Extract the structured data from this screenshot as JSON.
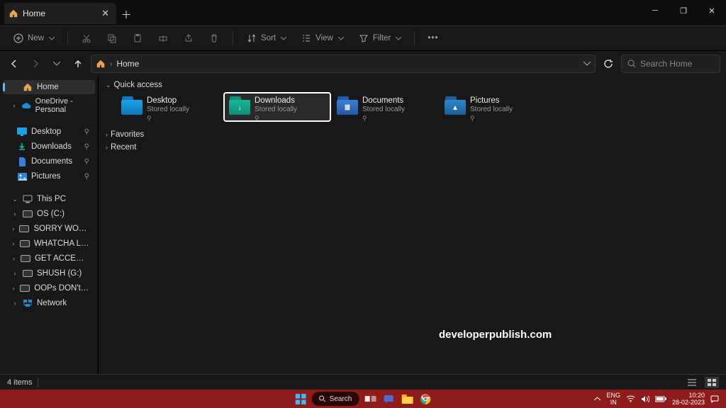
{
  "window": {
    "tab_title": "Home",
    "new_button": "New",
    "toolbar": {
      "sort": "Sort",
      "view": "View",
      "filter": "Filter"
    },
    "crumb": "Home",
    "search_placeholder": "Search Home",
    "status_count": "4 items"
  },
  "sidebar": {
    "home": "Home",
    "onedrive": "OneDrive - Personal",
    "desktop": "Desktop",
    "downloads": "Downloads",
    "documents": "Documents",
    "pictures": "Pictures",
    "thispc": "This PC",
    "drives": [
      "OS (C:)",
      "SORRY WORKAHOLIC (D:)",
      "WHATCHA LOOKING (E:)",
      "GET ACCESSED (F:)",
      "SHUSH (G:)",
      "OOPs DON't OPEN (H:)"
    ],
    "network": "Network"
  },
  "content": {
    "group_qa": "Quick access",
    "group_fav": "Favorites",
    "group_recent": "Recent",
    "tiles": [
      {
        "name": "Desktop",
        "sub": "Stored locally",
        "color1": "#1aa3e8",
        "color2": "#0f77b8",
        "highlight": false,
        "badge": ""
      },
      {
        "name": "Downloads",
        "sub": "Stored locally",
        "color1": "#17b597",
        "color2": "#0d8f75",
        "highlight": true,
        "badge": "↓"
      },
      {
        "name": "Documents",
        "sub": "Stored locally",
        "color1": "#3b7dd8",
        "color2": "#265aa3",
        "highlight": false,
        "badge": "≣"
      },
      {
        "name": "Pictures",
        "sub": "Stored locally",
        "color1": "#2f86d0",
        "color2": "#1e5e94",
        "highlight": false,
        "badge": "▲"
      }
    ]
  },
  "watermark": "developerpublish.com",
  "taskbar": {
    "search": "Search",
    "lang1": "ENG",
    "lang2": "IN",
    "time": "10:20",
    "date": "28-02-2023"
  }
}
